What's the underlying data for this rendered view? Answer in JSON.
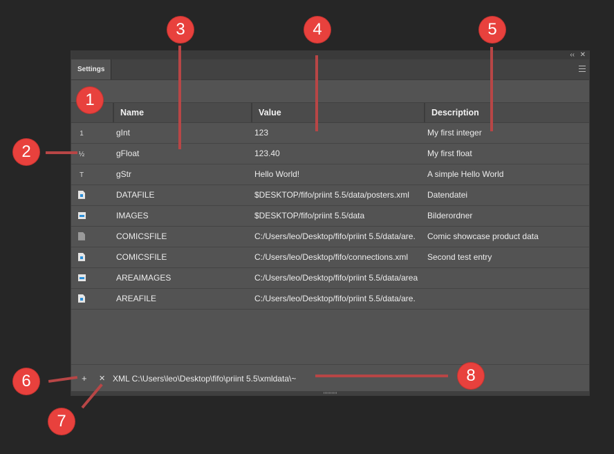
{
  "panel": {
    "tab": "Settings",
    "collapse_glyph": "‹‹",
    "close_glyph": "✕"
  },
  "table": {
    "columns": [
      "Name",
      "Value",
      "Description"
    ],
    "rows": [
      {
        "icon": "1",
        "icon_type": "int",
        "name": "gInt",
        "value": "123",
        "description": "My first integer"
      },
      {
        "icon": "½",
        "icon_type": "float",
        "name": "gFloat",
        "value": "123.40",
        "description": "My first float"
      },
      {
        "icon": "T",
        "icon_type": "string",
        "name": "gStr",
        "value": "Hello World!",
        "description": "A simple Hello World"
      },
      {
        "icon": "file-icon",
        "icon_type": "file",
        "name": "DATAFILE",
        "value": "$DESKTOP/fifo/priint 5.5/data/posters.xml",
        "description": "Datendatei"
      },
      {
        "icon": "folder-icon",
        "icon_type": "folder",
        "name": "IMAGES",
        "value": "$DESKTOP/fifo/priint 5.5/data",
        "description": "Bilderordner"
      },
      {
        "icon": "file-missing-icon",
        "icon_type": "file-grey",
        "name": "COMICSFILE",
        "value": "C:/Users/leo/Desktop/fifo/priint 5.5/data/are.",
        "description": "Comic showcase product data"
      },
      {
        "icon": "file-icon",
        "icon_type": "file",
        "name": "COMICSFILE",
        "value": "C:/Users/leo/Desktop/fifo/connections.xml",
        "description": "Second test entry"
      },
      {
        "icon": "folder-icon",
        "icon_type": "folder",
        "name": "AREAIMAGES",
        "value": "C:/Users/leo/Desktop/fifo/priint 5.5/data/area",
        "description": ""
      },
      {
        "icon": "file-icon",
        "icon_type": "file",
        "name": "AREAFILE",
        "value": "C:/Users/leo/Desktop/fifo/priint 5.5/data/are.",
        "description": ""
      }
    ]
  },
  "footer": {
    "add_glyph": "+",
    "remove_glyph": "✕",
    "path": "XML C:\\Users\\leo\\Desktop\\fifo\\priint 5.5\\xmldata\\~"
  },
  "callouts": [
    "1",
    "2",
    "3",
    "4",
    "5",
    "6",
    "7",
    "8"
  ],
  "colors": {
    "callout": "#e8413d",
    "callout_line": "#b84646",
    "file_accent": "#2b8fd9",
    "panel_bg": "#535353",
    "page_bg": "#262626"
  }
}
